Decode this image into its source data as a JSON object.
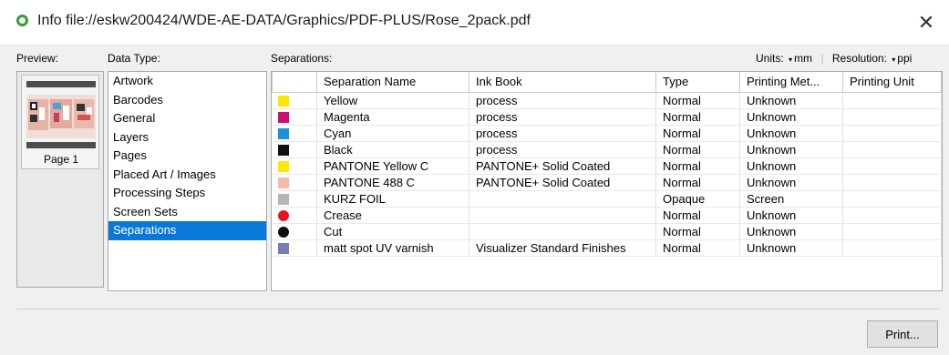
{
  "window": {
    "title": "Info file://eskw200424/WDE-AE-DATA/Graphics/PDF-PLUS/Rose_2pack.pdf",
    "close_glyph": "✕",
    "title_icon": "status-circle-icon"
  },
  "labels": {
    "preview": "Preview:",
    "data_type": "Data Type:",
    "separations": "Separations:"
  },
  "preview": {
    "page_label": "Page 1"
  },
  "units": {
    "units_label": "Units:",
    "units_value": "mm",
    "resolution_label": "Resolution:",
    "resolution_value": "ppi"
  },
  "data_types": [
    {
      "label": "Artwork",
      "selected": false
    },
    {
      "label": "Barcodes",
      "selected": false
    },
    {
      "label": "General",
      "selected": false
    },
    {
      "label": "Layers",
      "selected": false
    },
    {
      "label": "Pages",
      "selected": false
    },
    {
      "label": "Placed Art / Images",
      "selected": false
    },
    {
      "label": "Processing Steps",
      "selected": false
    },
    {
      "label": "Screen Sets",
      "selected": false
    },
    {
      "label": "Separations",
      "selected": true
    }
  ],
  "separations_table": {
    "columns": [
      "",
      "Separation Name",
      "Ink Book",
      "Type",
      "Printing Met...",
      "Printing Unit"
    ],
    "rows": [
      {
        "color": "#ffe600",
        "shape": "square",
        "name": "Yellow",
        "ink_book": "process",
        "type": "Normal",
        "method": "Unknown",
        "unit": ""
      },
      {
        "color": "#c8106e",
        "shape": "square",
        "name": "Magenta",
        "ink_book": "process",
        "type": "Normal",
        "method": "Unknown",
        "unit": ""
      },
      {
        "color": "#1e8fd8",
        "shape": "square",
        "name": "Cyan",
        "ink_book": "process",
        "type": "Normal",
        "method": "Unknown",
        "unit": ""
      },
      {
        "color": "#111111",
        "shape": "square",
        "name": "Black",
        "ink_book": "process",
        "type": "Normal",
        "method": "Unknown",
        "unit": ""
      },
      {
        "color": "#fde80a",
        "shape": "square",
        "name": "PANTONE Yellow C",
        "ink_book": "PANTONE+ Solid Coated",
        "type": "Normal",
        "method": "Unknown",
        "unit": ""
      },
      {
        "color": "#f4b9a8",
        "shape": "square",
        "name": "PANTONE 488 C",
        "ink_book": "PANTONE+ Solid Coated",
        "type": "Normal",
        "method": "Unknown",
        "unit": ""
      },
      {
        "color": "#b5b5b5",
        "shape": "square",
        "name": "KURZ FOIL",
        "ink_book": "",
        "type": "Opaque",
        "method": "Screen",
        "unit": ""
      },
      {
        "color": "#e8141c",
        "shape": "dot",
        "name": "Crease",
        "ink_book": "",
        "type": "Normal",
        "method": "Unknown",
        "unit": ""
      },
      {
        "color": "#0d0d0d",
        "shape": "dot",
        "name": "Cut",
        "ink_book": "",
        "type": "Normal",
        "method": "Unknown",
        "unit": ""
      },
      {
        "color": "#7a7ab8",
        "shape": "square",
        "name": "matt spot UV varnish",
        "ink_book": "Visualizer Standard Finishes",
        "type": "Normal",
        "method": "Unknown",
        "unit": ""
      }
    ]
  },
  "buttons": {
    "print": "Print..."
  }
}
